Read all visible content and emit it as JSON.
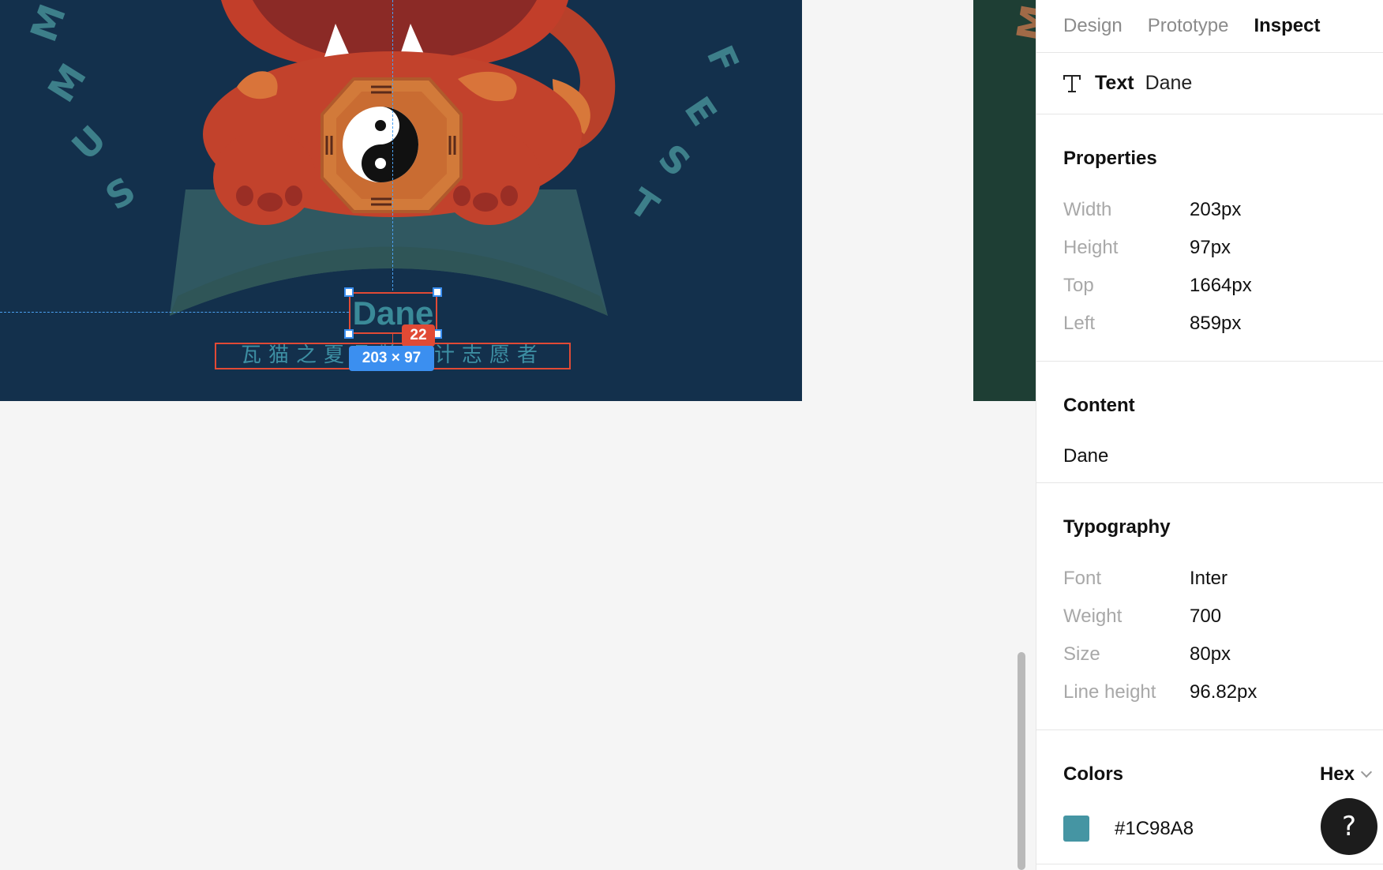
{
  "canvas": {
    "ring_left_letters": [
      "S",
      "U",
      "M",
      "M"
    ],
    "ring_right_letters": [
      "F",
      "E",
      "S",
      "T"
    ],
    "side_letter": "M",
    "selected_text": "Dane",
    "subtitle_text": "瓦猫之夏品牌设计志愿者",
    "distance_value": "22",
    "size_value": "203 × 97"
  },
  "panel": {
    "tabs": [
      "Design",
      "Prototype",
      "Inspect"
    ],
    "active_tab": "Inspect",
    "layer": {
      "kind": "Text",
      "name": "Dane"
    },
    "properties": {
      "title": "Properties",
      "rows": [
        {
          "label": "Width",
          "value": "203px"
        },
        {
          "label": "Height",
          "value": "97px"
        },
        {
          "label": "Top",
          "value": "1664px"
        },
        {
          "label": "Left",
          "value": "859px"
        }
      ]
    },
    "content": {
      "title": "Content",
      "text": "Dane"
    },
    "typography": {
      "title": "Typography",
      "rows": [
        {
          "label": "Font",
          "value": "Inter"
        },
        {
          "label": "Weight",
          "value": "700"
        },
        {
          "label": "Size",
          "value": "80px"
        },
        {
          "label": "Line height",
          "value": "96.82px"
        }
      ]
    },
    "colors": {
      "title": "Colors",
      "format": "Hex",
      "items": [
        {
          "hex": "#1C98A8",
          "swatch": "#4595a3"
        }
      ]
    }
  },
  "help_button": {
    "label": "?"
  }
}
